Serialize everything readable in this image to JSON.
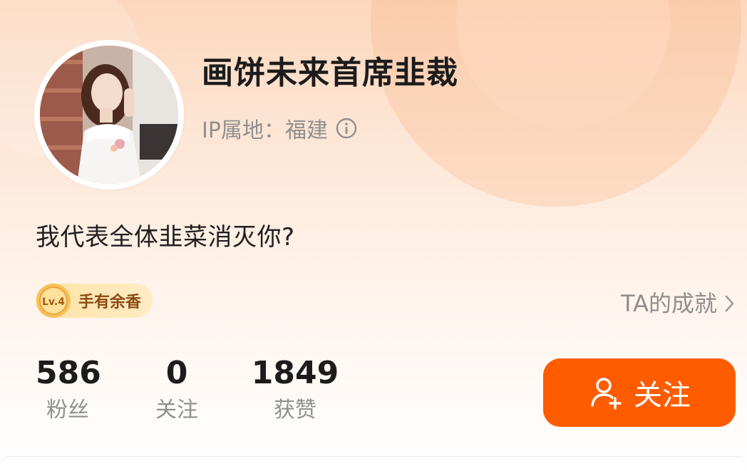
{
  "profile": {
    "username": "画饼未来首席韭裁",
    "ip_location": "IP属地：福建",
    "bio": "我代表全体韭菜消灭你?",
    "avatar_icon": "user-avatar-photo"
  },
  "level": {
    "badge": "Lv.4",
    "title": "手有余香"
  },
  "achievement": {
    "label": "TA的成就"
  },
  "stats": [
    {
      "value": "586",
      "label": "粉丝"
    },
    {
      "value": "0",
      "label": "关注"
    },
    {
      "value": "1849",
      "label": "获赞"
    }
  ],
  "follow_button": {
    "label": "关注",
    "icon": "add-user-icon"
  },
  "colors": {
    "accent": "#ff5c00",
    "badge_bg": "#ffe3a6",
    "badge_text": "#8c4a14",
    "muted_text": "#8f8f8f"
  }
}
